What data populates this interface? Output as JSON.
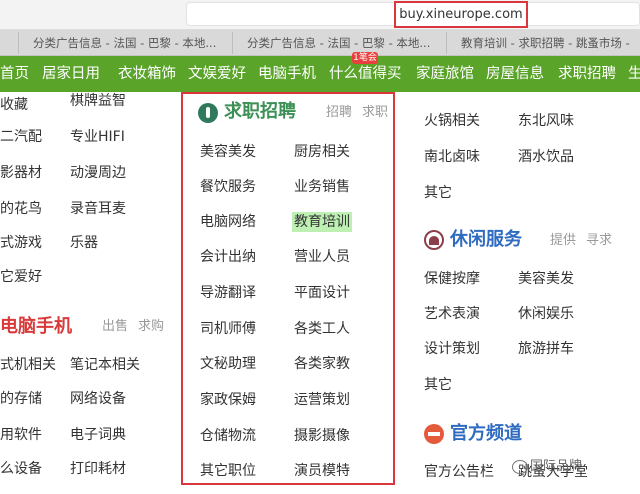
{
  "browser": {
    "url": "buy.xineurope.com",
    "tabs": [
      "分类广告信息 - 法国 - 巴黎 - 本地...",
      "分类广告信息 - 法国 - 巴黎 - 本地...",
      "教育培训 - 求职招聘 - 跳蚤市场 -"
    ]
  },
  "nav": {
    "items": [
      "首页",
      "居家日用",
      "衣妆箱饰",
      "文娱爱好",
      "电脑手机",
      "什么值得买",
      "家庭旅馆",
      "房屋信息",
      "求职招聘",
      "生"
    ],
    "badge": "1笔会"
  },
  "left_col": {
    "items": [
      "收藏",
      "二汽配",
      "影器材",
      "的花鸟",
      "式游戏",
      "它爱好"
    ],
    "items2": [
      "棋牌益智",
      "专业HIFI",
      "动漫周边",
      "录音耳麦",
      "乐器"
    ],
    "computer_title": "电脑手机",
    "computer_sub": [
      "出售",
      "求购"
    ],
    "computer_items": [
      "式机相关",
      "的存储",
      "用软件",
      "么设备"
    ],
    "computer_items2": [
      "笔记本相关",
      "网络设备",
      "电子词典",
      "打印耗材"
    ]
  },
  "jobs": {
    "title": "求职招聘",
    "sub": [
      "招聘",
      "求职"
    ],
    "col1": [
      "美容美发",
      "餐饮服务",
      "电脑网络",
      "会计出纳",
      "导游翻译",
      "司机师傅",
      "文秘助理",
      "家政保姆",
      "仓储物流",
      "其它职位"
    ],
    "col2": [
      "厨房相关",
      "业务销售",
      "教育培训",
      "营业人员",
      "平面设计",
      "各类工人",
      "各类家教",
      "运营策划",
      "摄影摄像",
      "演员模特"
    ],
    "highlighted": "教育培训"
  },
  "right_col": {
    "top_items": [
      "火锅相关",
      "南北卤味",
      "其它"
    ],
    "top_items2": [
      "东北风味",
      "酒水饮品"
    ],
    "leisure_title": "休闲服务",
    "leisure_sub": [
      "提供",
      "寻求"
    ],
    "leisure_col1": [
      "保健按摩",
      "艺术表演",
      "设计策划",
      "其它"
    ],
    "leisure_col2": [
      "美容美发",
      "休闲娱乐",
      "旅游拼车"
    ],
    "official_title": "官方频道",
    "official_items": [
      "官方公告栏",
      "跳蚤大学堂"
    ],
    "watermark": "国际品牌"
  },
  "colors": {
    "nav_green": "#5aa42a",
    "highlight_red": "#d9363e",
    "title_blue": "#3a6fb0"
  }
}
